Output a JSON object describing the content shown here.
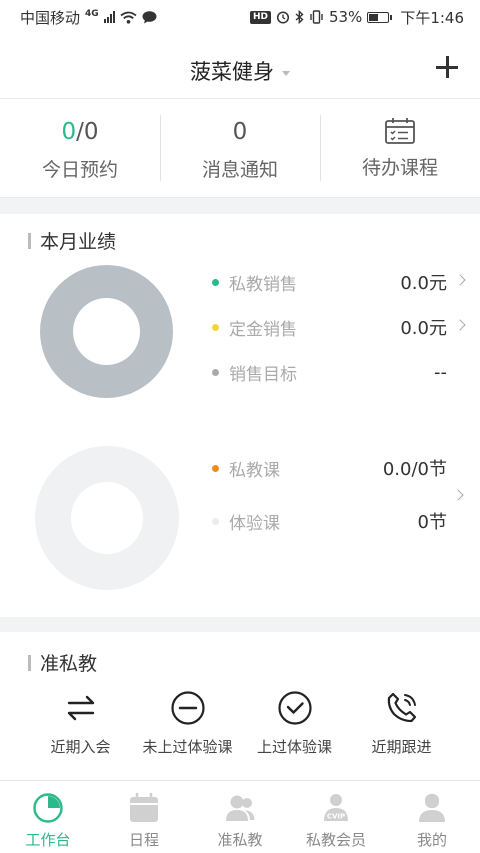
{
  "status_bar": {
    "carrier": "中国移动",
    "network": "4G",
    "hd": "HD",
    "battery_percent": "53%",
    "battery_level": 0.53,
    "time": "下午1:46"
  },
  "header": {
    "title": "菠菜健身"
  },
  "stats": {
    "today": {
      "done": "0",
      "total": "/0",
      "label": "今日预约"
    },
    "messages": {
      "count": "0",
      "label": "消息通知"
    },
    "todo": {
      "label": "待办课程"
    }
  },
  "performance": {
    "title": "本月业绩",
    "sales": [
      {
        "label": "私教销售",
        "value": "0.0元",
        "color": "#2bb88a"
      },
      {
        "label": "定金销售",
        "value": "0.0元",
        "color": "#f5d33a"
      },
      {
        "label": "销售目标",
        "value": "--",
        "color": "#a9a9a9"
      }
    ],
    "courses": [
      {
        "label": "私教课",
        "value": "0.0/0节",
        "color": "#f08a1f"
      },
      {
        "label": "体验课",
        "value": "0节",
        "color": "#ececec"
      }
    ],
    "colors": {
      "donut_sales": "#b8c0c5",
      "donut_courses": "#f0f1f3"
    }
  },
  "pre_private": {
    "title": "准私教",
    "actions": [
      {
        "label": "近期入会",
        "icon": "exchange-arrows-icon"
      },
      {
        "label": "未上过体验课",
        "icon": "minus-circle-icon"
      },
      {
        "label": "上过体验课",
        "icon": "check-circle-icon"
      },
      {
        "label": "近期跟进",
        "icon": "phone-call-icon"
      }
    ]
  },
  "tabs": [
    {
      "label": "工作台",
      "icon": "pie-chart-icon",
      "active": true
    },
    {
      "label": "日程",
      "icon": "calendar-icon",
      "active": false
    },
    {
      "label": "准私教",
      "icon": "users-icon",
      "active": false
    },
    {
      "label": "私教会员",
      "icon": "vip-member-icon",
      "active": false
    },
    {
      "label": "我的",
      "icon": "person-icon",
      "active": false
    }
  ],
  "accent_color": "#2bb88a"
}
